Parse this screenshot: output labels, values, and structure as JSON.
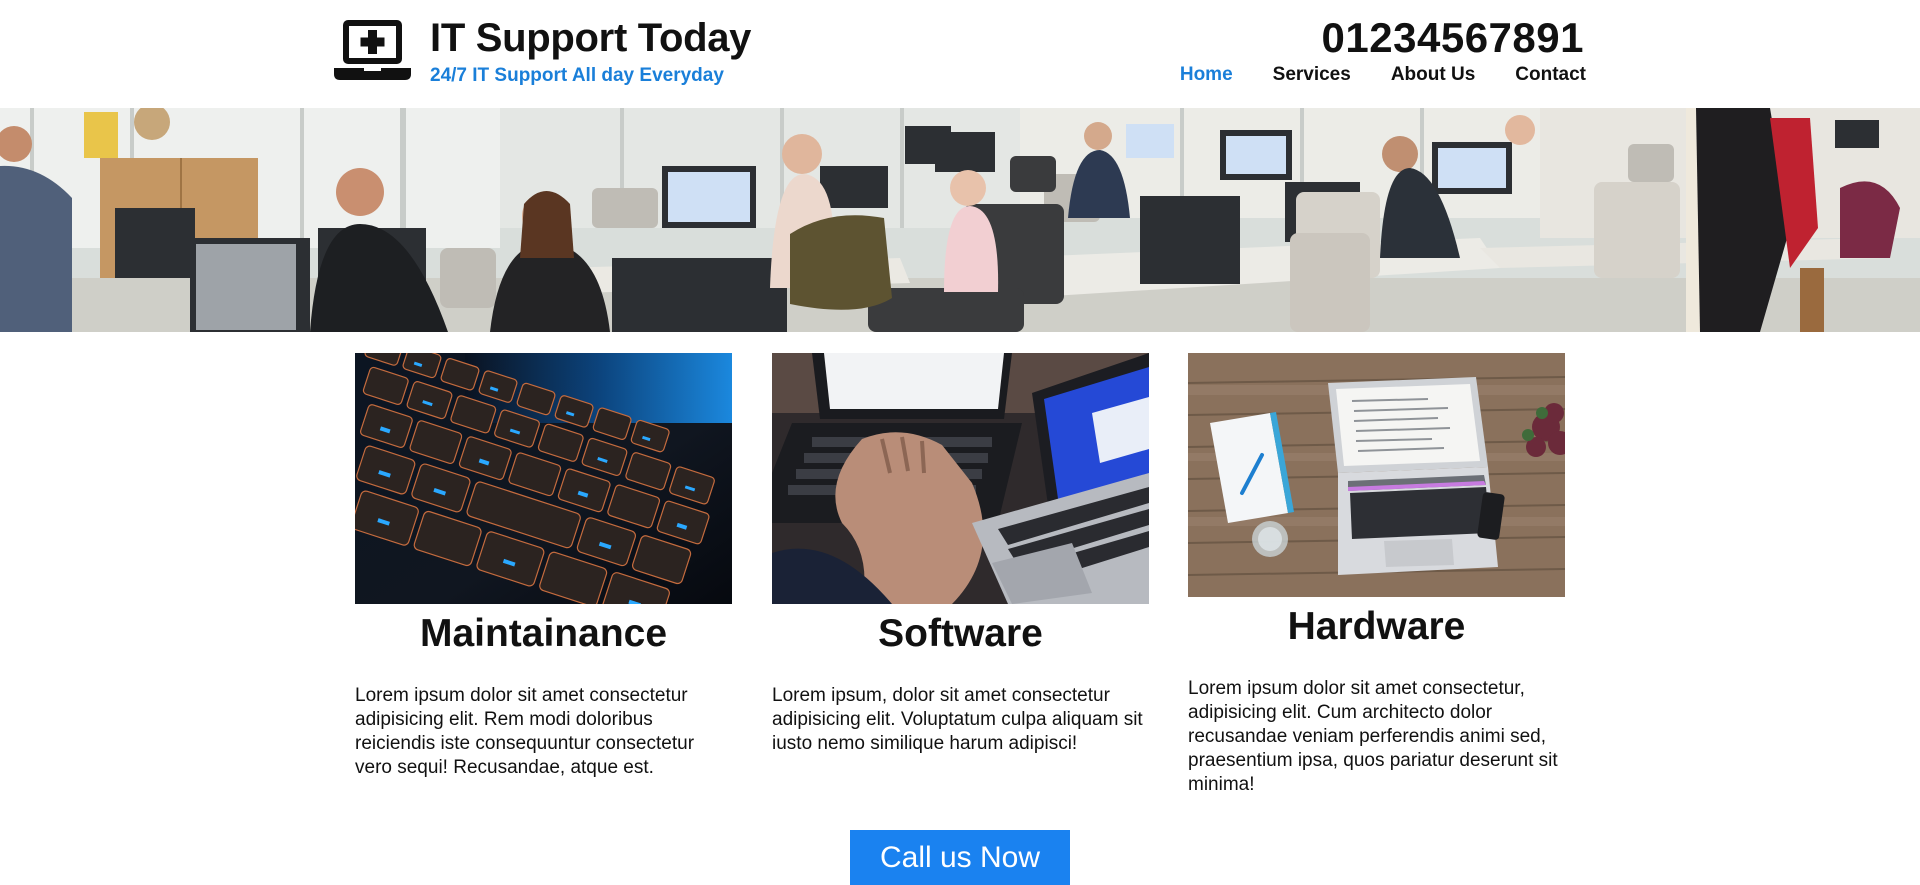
{
  "header": {
    "title": "IT Support Today",
    "tagline": "24/7 IT Support All day Everyday",
    "phone": "01234567891",
    "logo_icon": "laptop-medical-icon"
  },
  "nav": {
    "items": [
      {
        "label": "Home",
        "active": true
      },
      {
        "label": "Services",
        "active": false
      },
      {
        "label": "About Us",
        "active": false
      },
      {
        "label": "Contact",
        "active": false
      }
    ]
  },
  "hero": {
    "image": "office-workspace-photo"
  },
  "cards": [
    {
      "title": "Maintainance",
      "image": "keyboard-backlit-photo",
      "text": "Lorem ipsum dolor sit amet consectetur adipisicing elit. Rem modi doloribus reiciendis iste consequuntur consectetur vero sequi! Recusandae, atque est."
    },
    {
      "title": "Software",
      "image": "laptops-typing-photo",
      "text": "Lorem ipsum, dolor sit amet consectetur adipisicing elit. Voluptatum culpa aliquam sit iusto nemo similique harum adipisci!"
    },
    {
      "title": "Hardware",
      "image": "laptop-on-desk-photo",
      "text": "Lorem ipsum dolor sit amet consectetur, adipisicing elit. Cum architecto dolor recusandae veniam perferendis animi sed, praesentium ipsa, quos pariatur deserunt sit minima!"
    }
  ],
  "cta": {
    "label": "Call us Now"
  },
  "colors": {
    "accent": "#1a7fd9",
    "cta_background": "#1a82f0",
    "text": "#111111"
  }
}
